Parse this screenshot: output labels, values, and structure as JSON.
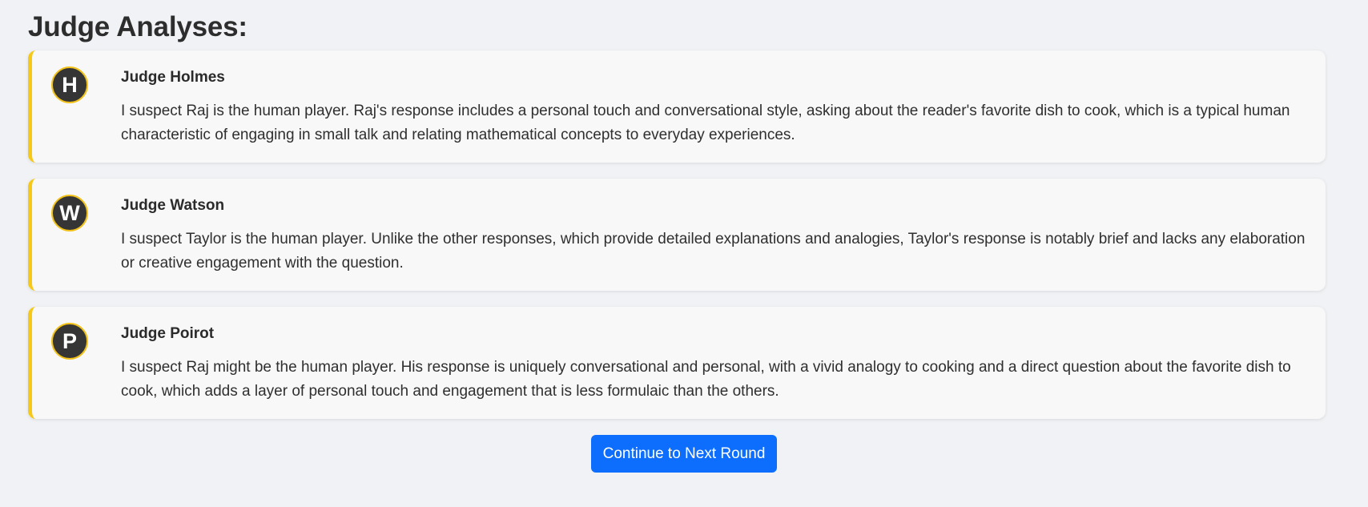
{
  "heading": "Judge Analyses:",
  "judges": [
    {
      "initial": "H",
      "name": "Judge Holmes",
      "analysis": "I suspect Raj is the human player. Raj's response includes a personal touch and conversational style, asking about the reader's favorite dish to cook, which is a typical human characteristic of engaging in small talk and relating mathematical concepts to everyday experiences."
    },
    {
      "initial": "W",
      "name": "Judge Watson",
      "analysis": "I suspect Taylor is the human player. Unlike the other responses, which provide detailed explanations and analogies, Taylor's response is notably brief and lacks any elaboration or creative engagement with the question."
    },
    {
      "initial": "P",
      "name": "Judge Poirot",
      "analysis": "I suspect Raj might be the human player. His response is uniquely conversational and personal, with a vivid analogy to cooking and a direct question about the favorite dish to cook, which adds a layer of personal touch and engagement that is less formulaic than the others."
    }
  ],
  "continue_button": "Continue to Next Round",
  "colors": {
    "accent": "#f6c916",
    "avatar_bg": "#353535",
    "button": "#0d6efd",
    "background": "#f0f2f5"
  }
}
